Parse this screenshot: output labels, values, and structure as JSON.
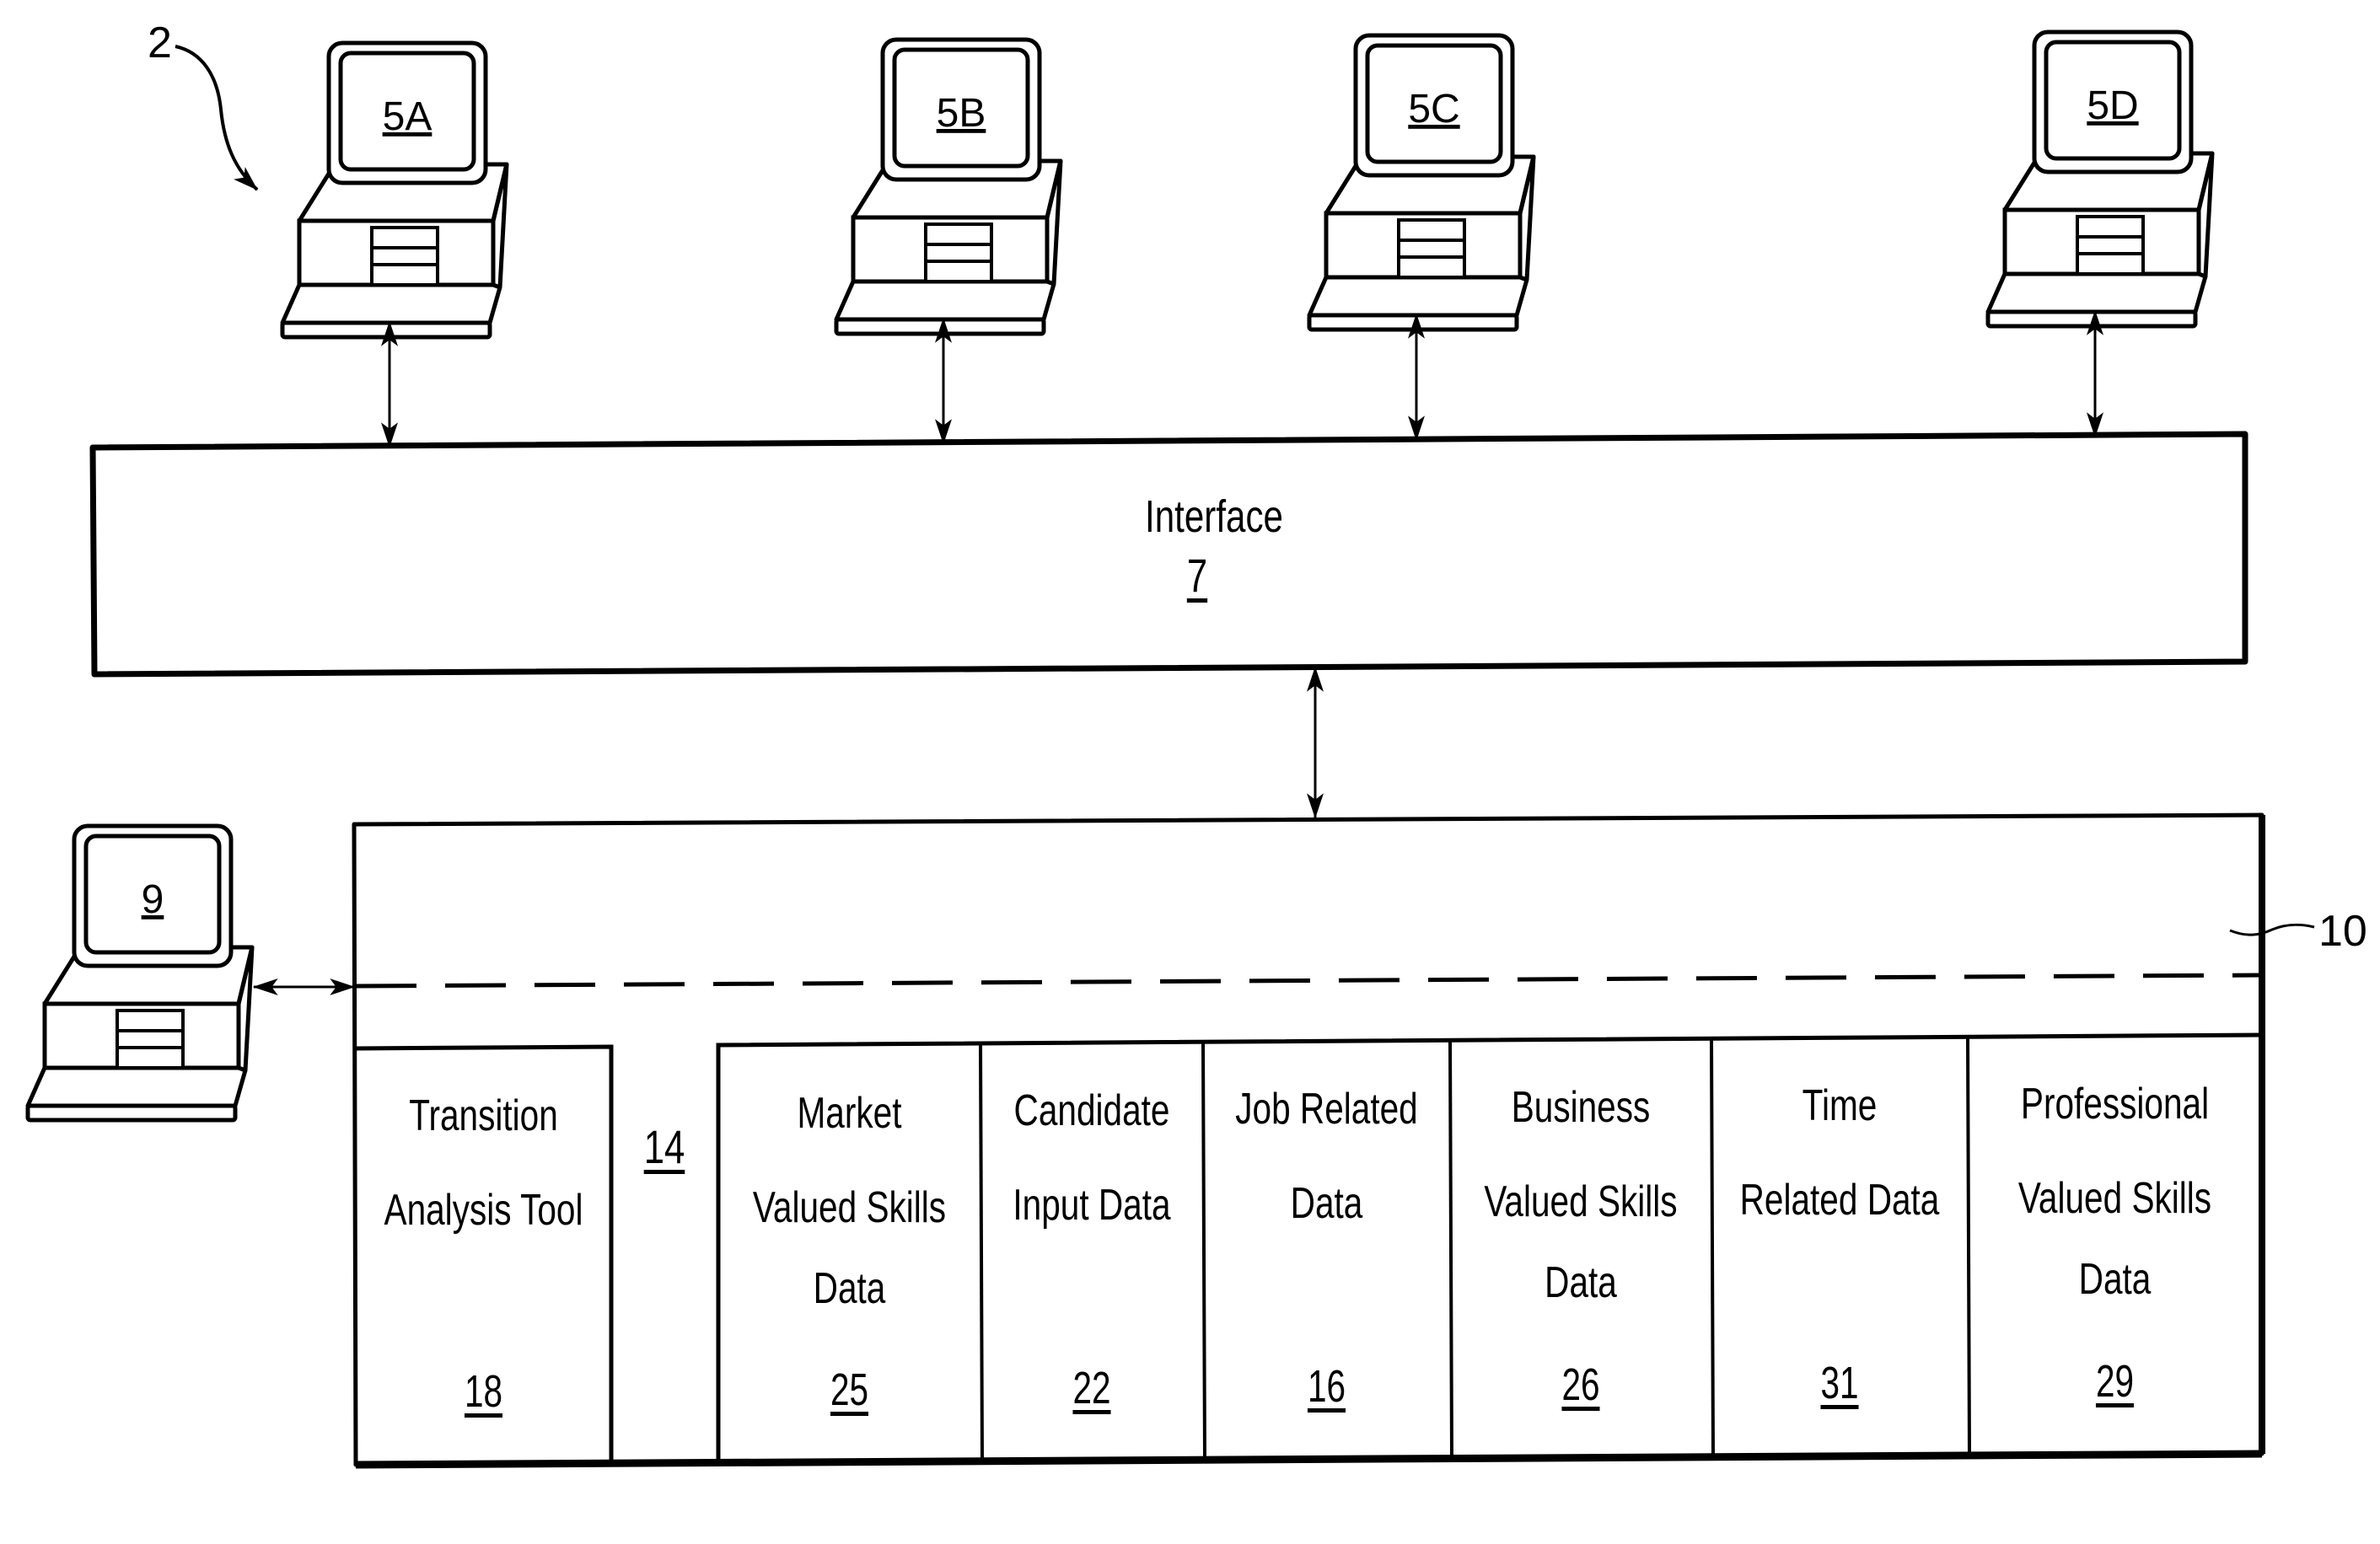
{
  "figure": {
    "system_ref": "2",
    "database_ref": "10",
    "interface": {
      "label": "Interface",
      "ref": "7"
    },
    "admin_terminal": {
      "ref": "9"
    },
    "user_terminals": [
      {
        "ref": "5A"
      },
      {
        "ref": "5B"
      },
      {
        "ref": "5C"
      },
      {
        "ref": "5D"
      }
    ],
    "gap_ref": "14",
    "modules": [
      {
        "lines": [
          "Transition",
          "Analysis Tool"
        ],
        "ref": "18"
      },
      {
        "lines": [
          "Market",
          "Valued Skills",
          "Data"
        ],
        "ref": "25"
      },
      {
        "lines": [
          "Candidate",
          "Input Data"
        ],
        "ref": "22"
      },
      {
        "lines": [
          "Job Related",
          "Data"
        ],
        "ref": "16"
      },
      {
        "lines": [
          "Business",
          "Valued Skills",
          "Data"
        ],
        "ref": "26"
      },
      {
        "lines": [
          "Time",
          "Related Data"
        ],
        "ref": "31"
      },
      {
        "lines": [
          "Professional",
          "Valued Skills",
          "Data"
        ],
        "ref": "29"
      }
    ]
  }
}
